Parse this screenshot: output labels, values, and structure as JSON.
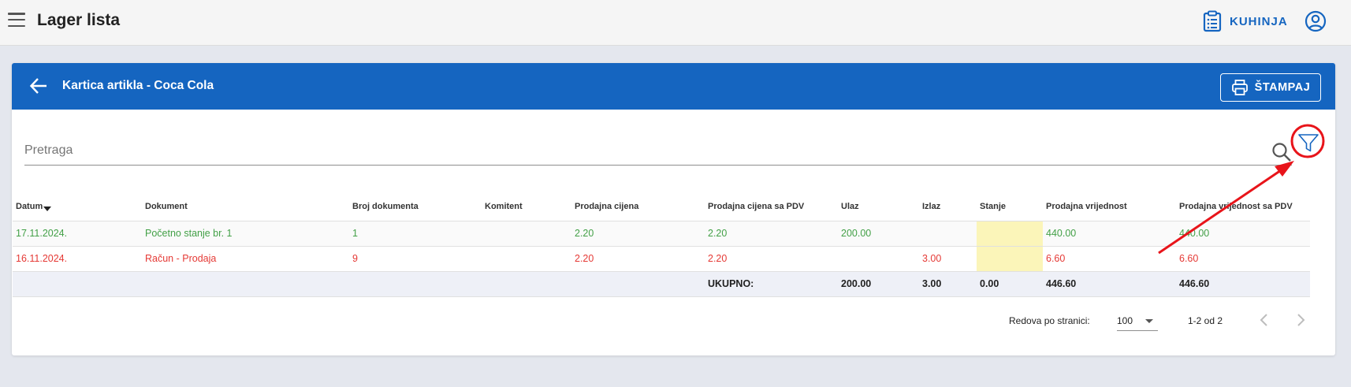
{
  "header": {
    "title": "Lager lista",
    "kitchen_label": "KUHINJA"
  },
  "card": {
    "title": "Kartica artikla - Coca Cola",
    "print_label": "ŠTAMPAJ"
  },
  "search": {
    "placeholder": "Pretraga"
  },
  "table": {
    "columns": [
      "Datum",
      "Dokument",
      "Broj dokumenta",
      "Komitent",
      "Prodajna cijena",
      "Prodajna cijena sa PDV",
      "Ulaz",
      "Izlaz",
      "Stanje",
      "Prodajna vrijednost",
      "Prodajna vrijednost sa PDV"
    ],
    "rows": [
      [
        "17.11.2024.",
        "Početno stanje br. 1",
        "1",
        "",
        "2.20",
        "2.20",
        "200.00",
        "",
        "",
        "440.00",
        "440.00"
      ],
      [
        "16.11.2024.",
        "Račun - Prodaja",
        "9",
        "",
        "2.20",
        "2.20",
        "",
        "3.00",
        "",
        "6.60",
        "6.60"
      ]
    ],
    "total": [
      "",
      "",
      "",
      "",
      "",
      "UKUPNO:",
      "200.00",
      "3.00",
      "0.00",
      "446.60",
      "446.60"
    ]
  },
  "pager": {
    "rows_label": "Redova po stranici:",
    "rows_value": "100",
    "range": "1-2 od 2"
  },
  "colors": {
    "primary": "#1565c0",
    "positive": "#43a047",
    "negative": "#e53935",
    "highlight": "#fbf5b9",
    "annotation": "#e8141a"
  }
}
